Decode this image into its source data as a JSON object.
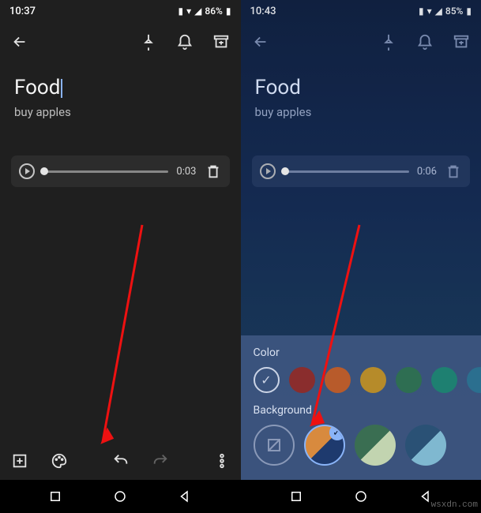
{
  "left": {
    "status": {
      "time": "10:37",
      "battery": "86%"
    },
    "note": {
      "title": "Food",
      "body": "buy apples"
    },
    "audio": {
      "duration": "0:03"
    }
  },
  "right": {
    "status": {
      "time": "10:43",
      "battery": "85%"
    },
    "note": {
      "title": "Food",
      "body": "buy apples"
    },
    "audio": {
      "duration": "0:06"
    },
    "sheet": {
      "color_label": "Color",
      "background_label": "Background",
      "colors": [
        "#8a2d2d",
        "#b85b2b",
        "#b68b2a",
        "#2e6e52",
        "#1e8071",
        "#2b6f8f",
        "#3a5286"
      ],
      "backgrounds": [
        {
          "type": "none"
        },
        {
          "type": "bg",
          "c1": "#d88a3e",
          "c2": "#1e3a6e",
          "selected": true
        },
        {
          "type": "bg",
          "c1": "#3a6e52",
          "c2": "#c2d4b0"
        },
        {
          "type": "bg",
          "c1": "#2a5175",
          "c2": "#7fb8d0"
        }
      ]
    }
  },
  "watermark": "wsxdn.com"
}
